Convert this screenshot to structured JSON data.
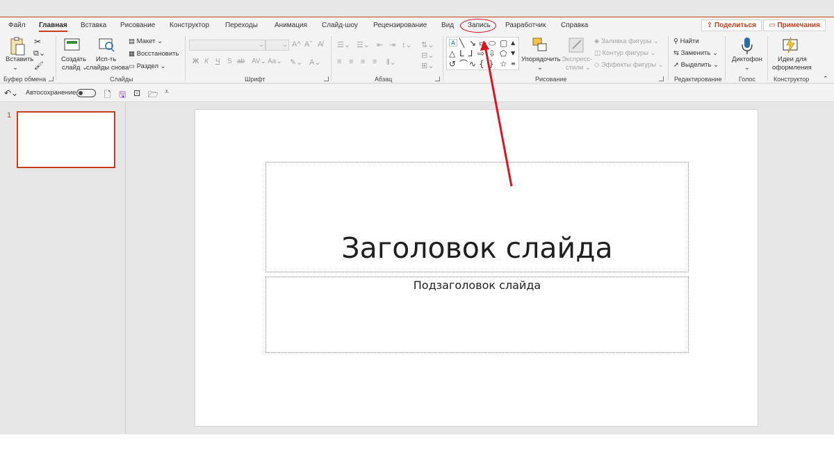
{
  "tabs": [
    {
      "label": "Файл"
    },
    {
      "label": "Главная"
    },
    {
      "label": "Вставка"
    },
    {
      "label": "Рисование"
    },
    {
      "label": "Конструктор"
    },
    {
      "label": "Переходы"
    },
    {
      "label": "Анимация"
    },
    {
      "label": "Слайд-шоу"
    },
    {
      "label": "Рецензирование"
    },
    {
      "label": "Вид"
    },
    {
      "label": "Запись"
    },
    {
      "label": "Разработчик"
    },
    {
      "label": "Справка"
    }
  ],
  "active_tab": "Главная",
  "highlighted_tab": "Запись",
  "share_label": "Поделиться",
  "notes_label": "Примечания",
  "ribbon": {
    "clipboard": {
      "paste": "Вставить",
      "group": "Буфер обмена"
    },
    "slides": {
      "new_slide_line1": "Создать",
      "new_slide_line2": "слайд",
      "reuse_line1": "Исп-ть",
      "reuse_line2": "слайды снова",
      "layout": "Макет",
      "reset": "Восстановить",
      "section": "Раздел",
      "group": "Слайды"
    },
    "font": {
      "bold": "Ж",
      "italic": "К",
      "underline": "Ч",
      "strike": "S",
      "spacing": "ab",
      "case": "Aa",
      "group": "Шрифт"
    },
    "paragraph": {
      "group": "Абзац"
    },
    "drawing": {
      "arrange": "Упорядочить",
      "quick_styles_line1": "Экспресс-",
      "quick_styles_line2": "стили",
      "fill": "Заливка фигуры",
      "outline": "Контур фигуры",
      "effects": "Эффекты фигуры",
      "group": "Рисование"
    },
    "editing": {
      "find": "Найти",
      "replace": "Заменить",
      "select": "Выделить",
      "group": "Редактирование"
    },
    "voice": {
      "dictate": "Диктофон",
      "group": "Голос"
    },
    "designer": {
      "ideas_line1": "Идеи для",
      "ideas_line2": "оформления",
      "group": "Конструктор"
    }
  },
  "qat": {
    "autosave": "Автосохранение"
  },
  "thumbnails": [
    {
      "number": "1"
    }
  ],
  "slide": {
    "title": "Заголовок слайда",
    "subtitle": "Подзаголовок слайда"
  },
  "colors": {
    "accent": "#c43e1c",
    "annotation": "#e0101d"
  },
  "icons": [
    "undo-icon",
    "paste-icon",
    "cut-icon",
    "copy-icon",
    "format-painter-icon",
    "new-slide-icon",
    "reuse-slides-icon",
    "layout-icon",
    "reset-icon",
    "section-icon",
    "bullets-icon",
    "numbering-icon",
    "align-icon",
    "shapes-gallery",
    "arrange-icon",
    "quick-styles-icon",
    "find-icon",
    "replace-icon",
    "select-icon",
    "microphone-icon",
    "designer-icon",
    "save-icon",
    "new-file-icon",
    "open-icon",
    "present-icon",
    "annotation-arrow"
  ]
}
